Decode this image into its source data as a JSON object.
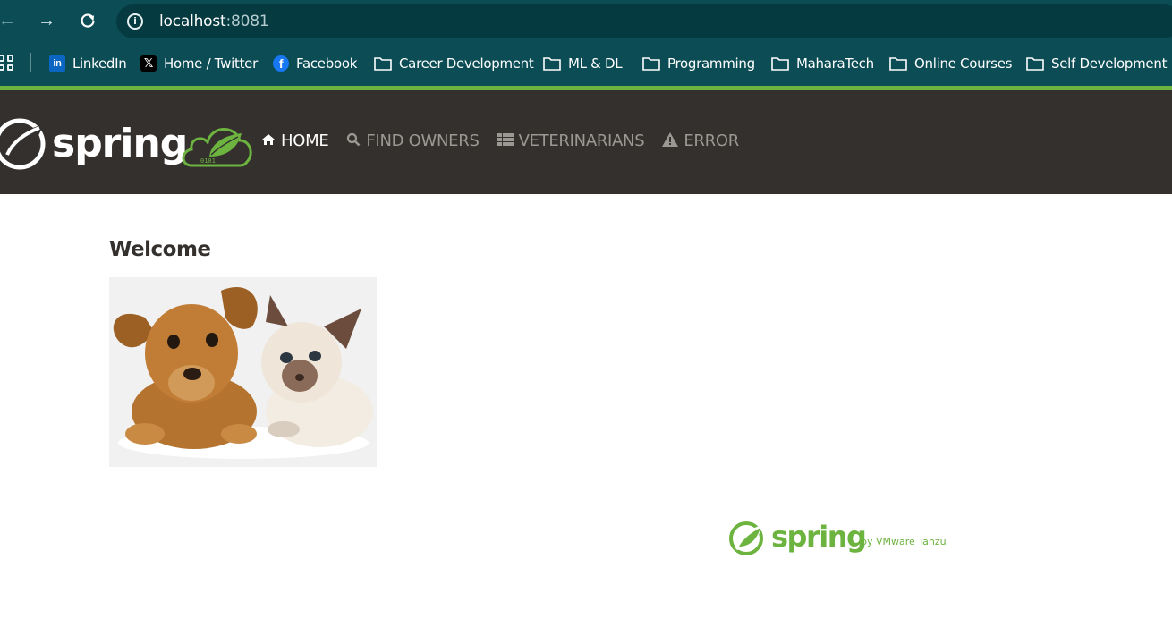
{
  "browser": {
    "url_host": "localhost",
    "url_port": ":8081"
  },
  "bookmarks": [
    {
      "label": "LinkedIn",
      "icon": "linkedin-icon"
    },
    {
      "label": "Home / Twitter",
      "icon": "x-icon"
    },
    {
      "label": "Facebook",
      "icon": "facebook-icon"
    },
    {
      "label": "Career Development",
      "icon": "folder-icon"
    },
    {
      "label": "ML & DL",
      "icon": "folder-icon"
    },
    {
      "label": "Programming",
      "icon": "folder-icon"
    },
    {
      "label": "MaharaTech",
      "icon": "folder-icon"
    },
    {
      "label": "Online Courses",
      "icon": "folder-icon"
    },
    {
      "label": "Self Development",
      "icon": "folder-icon"
    }
  ],
  "navbar": {
    "logo_text": "spring",
    "items": [
      {
        "label": "HOME",
        "icon": "home-icon",
        "active": true
      },
      {
        "label": "FIND OWNERS",
        "icon": "search-icon",
        "active": false
      },
      {
        "label": "VETERINARIANS",
        "icon": "list-icon",
        "active": false
      },
      {
        "label": "ERROR",
        "icon": "warning-icon",
        "active": false
      }
    ]
  },
  "main": {
    "heading": "Welcome"
  },
  "footer": {
    "brand": "spring",
    "byline": "by VMware Tanzu"
  },
  "colors": {
    "chrome": "#0b4c55",
    "spring_green": "#6db33f",
    "navbar_bg": "#34302d"
  }
}
